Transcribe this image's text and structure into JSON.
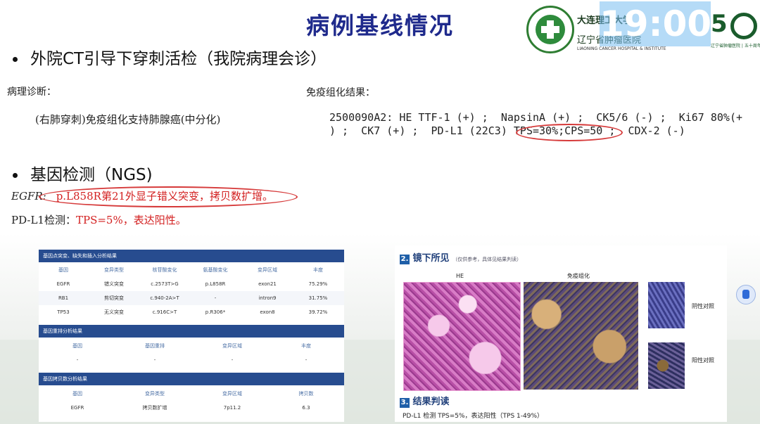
{
  "slide": {
    "title": "病例基线情况",
    "clock": "19:00",
    "logo_line1": "大连理工大学",
    "logo_line2": "辽宁省肿瘤医院",
    "logo_en": "LIAONING CANCER HOSPITAL & INSTITUTE",
    "anniv_caption": "辽宁省肿瘤医院 | 五十周年庆"
  },
  "bullet1": "外院CT引导下穿刺活检（我院病理会诊）",
  "pathology": {
    "label": "病理诊断：",
    "text": "(右肺穿刺)免疫组化支持肺腺癌(中分化)"
  },
  "ihc": {
    "label": "免疫组化结果：",
    "line1": "2500090A2: HE TTF-1 (+) ;  NapsinA (+) ;  CK5/6 (-) ;  Ki67 80%(+",
    "line2a": ") ;  CK7 (+) ;  PD-L1 (22C3) ",
    "line2_highlight": "TPS=30%;CPS=50",
    "line2b": " ;  CDX-2 (-)"
  },
  "bullet2": "基因检测（NGS)",
  "egfr": {
    "label": "EGFR:",
    "text": "p.L858R第21外显子错义突变，拷贝数扩增。"
  },
  "pdl1_ngs": {
    "label": "PD-L1检测：",
    "text": "TPS=5%，表达阳性。"
  },
  "report_table": {
    "section1": "基因点突变、缺失和插入分析结果",
    "headers1": [
      "基因",
      "变异类型",
      "核苷酸变化",
      "氨基酸变化",
      "变异区域",
      "丰度"
    ],
    "rows1": [
      [
        "EGFR",
        "错义突变",
        "c.2573T>G",
        "p.L858R",
        "exon21",
        "75.29%"
      ],
      [
        "RB1",
        "剪切突变",
        "c.940-2A>T",
        "-",
        "intron9",
        "31.75%"
      ],
      [
        "TP53",
        "无义突变",
        "c.916C>T",
        "p.R306*",
        "exon8",
        "39.72%"
      ]
    ],
    "section2": "基因重排分析结果",
    "headers2": [
      "基因",
      "基因重排",
      "变异区域",
      "丰度"
    ],
    "rows2": [
      [
        "-",
        "-",
        "-",
        "-"
      ]
    ],
    "section3": "基因拷贝数分析结果",
    "headers3": [
      "基因",
      "变异类型",
      "变异区域",
      "拷贝数"
    ],
    "rows3": [
      [
        "EGFR",
        "拷贝数扩增",
        "7p11.2",
        "6.3"
      ]
    ]
  },
  "micro": {
    "sec2_num": "2.",
    "sec2_title": "镜下所见",
    "sec2_note": "（仅供参考，具体见结果判读）",
    "he_label": "HE",
    "ihc_label": "免疫组化",
    "neg_label": "阴性对照",
    "pos_label": "阳性对照",
    "sec3_num": "3.",
    "sec3_title": "结果判读",
    "result": "PD-L1 检测 TPS=5%，表达阳性（TPS 1-49%）"
  }
}
